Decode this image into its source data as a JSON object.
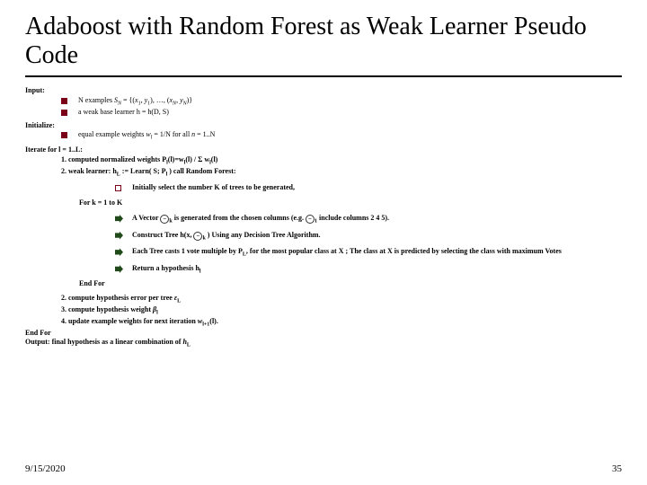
{
  "title": "Adaboost with Random Forest as Weak Learner Pseudo Code",
  "sections": {
    "input_hdr": "Input:",
    "input_line1": "N examples S_N = {(x_1, y_1), …, (x_N, y_N)}",
    "input_line2": "a weak base learner h = h(D, S)",
    "init_hdr": "Initialize:",
    "init_line": "equal example weights w_l = 1/N for all n = 1..N",
    "iterate_hdr": "Iterate for l = 1..L:",
    "step1": "1. computed normalized weights P_l(l) = w_l(l) / Σ w_l(l)",
    "step2": "2. weak learner: h_L := Learn( S; P_l ) call Random Forest:",
    "rf_pick_k": "Initially select the number K of trees to be generated,",
    "for_k": "For k = 1 to K",
    "vec_a": "A Vector ",
    "vec_b": " is generated from the chosen columns (e.g. ",
    "vec_c": " include columns 2 4 5).",
    "construct_a": "Construct Tree h(x, ",
    "construct_b": ") Using any Decision Tree Algorithm.",
    "eachtree": "Each Tree casts 1 vote multiple by P_L, for the most popular class at X ; The class at X is predicted by selecting the class with maximum Votes",
    "return_hyp": "Return a hypothesis h_l",
    "endfor_inner": "End For",
    "step_err": "2. compute hypothesis error per tree ε_L",
    "step_wt": "3. compute hypothesis weight β_l",
    "step_upd": "4. update example weights for next iteration w_{l+1}(l).",
    "endfor_outer": "End For",
    "output": "Output: final hypothesis as a linear combination of h_L"
  },
  "footer": {
    "date": "9/15/2020",
    "page": "35"
  }
}
